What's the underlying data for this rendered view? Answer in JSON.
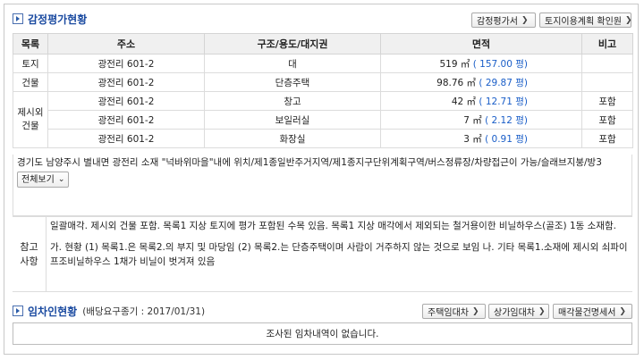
{
  "appraisal": {
    "title": "감정평가현황",
    "buttons": [
      "감정평가서",
      "토지이용계획 확인원"
    ],
    "headers": [
      "목록",
      "주소",
      "구조/용도/대지권",
      "면적",
      "비고"
    ],
    "rows": [
      {
        "category": "토지",
        "address": "광전리 601-2",
        "structure": "대",
        "area": "519 ㎡",
        "pyeong": "( 157.00 평)",
        "note": ""
      },
      {
        "category": "건물",
        "address": "광전리 601-2",
        "structure": "단층주택",
        "area": "98.76 ㎡",
        "pyeong": "( 29.87 평)",
        "note": ""
      },
      {
        "category": "제시외 건물",
        "address": "광전리 601-2",
        "structure": "창고",
        "area": "42 ㎡",
        "pyeong": "( 12.71 평)",
        "note": "포함"
      },
      {
        "category": "",
        "address": "광전리 601-2",
        "structure": "보일러실",
        "area": "7 ㎡",
        "pyeong": "( 2.12 평)",
        "note": "포함"
      },
      {
        "category": "",
        "address": "광전리 601-2",
        "structure": "화장실",
        "area": "3 ㎡",
        "pyeong": "( 0.91 평)",
        "note": "포함"
      }
    ],
    "description": "경기도 남양주시 별내면 광전리 소재 \"넉바위마을\"내에 위치/제1종일반주거지역/제1종지구단위계획구역/버스정류장/차량접근이 가능/슬래브지붕/방3",
    "full_view": "전체보기",
    "notes_label": "참고사항",
    "notes": [
      "일괄매각. 제시외 건물 포함. 목록1 지상 토지에 평가 포함된 수목 있음. 목록1 지상 매각에서 제외되는 철거용이한 비닐하우스(골조) 1동 소재함.",
      "가. 현황 (1) 목록1.은 목록2.의 부지 및 마당임 (2) 목록2.는 단층주택이며 사람이 거주하지 않는 것으로 보임 나. 기타 목록1.소재에 제시외 쇠파이프조비닐하우스 1채가 비닐이 벗겨져 있음"
    ]
  },
  "tenant": {
    "title": "임차인현황",
    "subtitle": "(배당요구종기 : 2017/01/31)",
    "buttons": [
      "주택임대차",
      "상가임대차",
      "매각물건명세서"
    ],
    "empty_message": "조사된 임차내역이 없습니다."
  }
}
